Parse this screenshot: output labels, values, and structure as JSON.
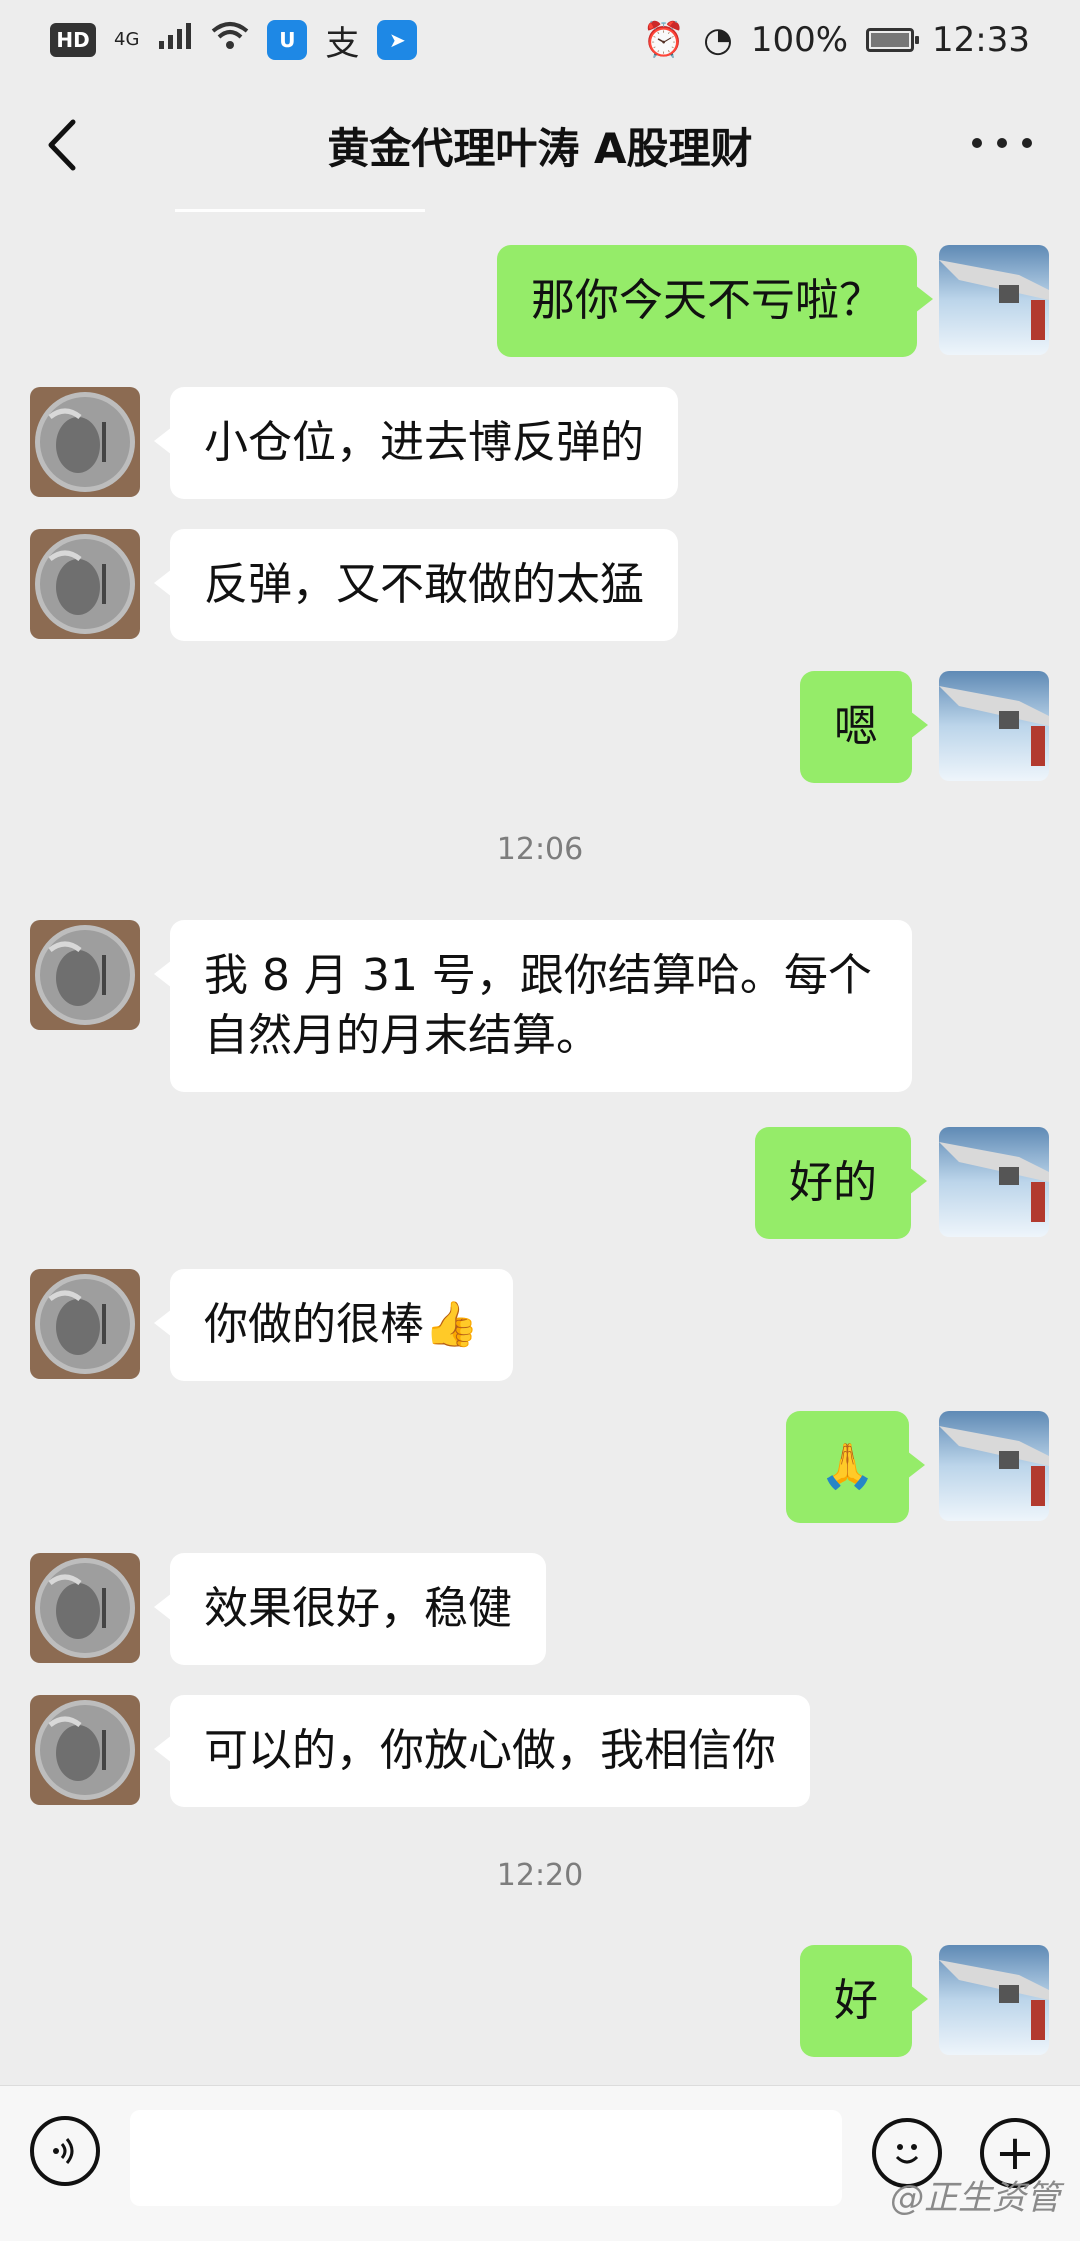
{
  "status_bar": {
    "hd": "HD",
    "network": "4G",
    "battery_percent": "100%",
    "time": "12:33",
    "pay_icon_text": "支"
  },
  "header": {
    "title": "黄金代理叶涛 A股理财"
  },
  "messages": [
    {
      "side": "right",
      "text": "那你今天不亏啦？"
    },
    {
      "side": "left",
      "text": "小仓位，进去博反弹的"
    },
    {
      "side": "left",
      "text": "反弹，又不敢做的太猛"
    },
    {
      "side": "right",
      "text": "嗯"
    },
    {
      "side": "time",
      "text": "12:06"
    },
    {
      "side": "left",
      "text": "我 8 月 31 号，跟你结算哈。每个自然月的月末结算。"
    },
    {
      "side": "right",
      "text": "好的"
    },
    {
      "side": "left",
      "text": "你做的很棒👍"
    },
    {
      "side": "right",
      "text": "🙏"
    },
    {
      "side": "left",
      "text": "效果很好，稳健"
    },
    {
      "side": "left",
      "text": "可以的，你放心做，我相信你"
    },
    {
      "side": "time",
      "text": "12:20"
    },
    {
      "side": "right",
      "text": "好"
    }
  ],
  "input_bar": {
    "placeholder": ""
  },
  "watermark": "@正生资管",
  "colors": {
    "background": "#ededed",
    "bubble_left": "#ffffff",
    "bubble_right": "#95ec69"
  }
}
